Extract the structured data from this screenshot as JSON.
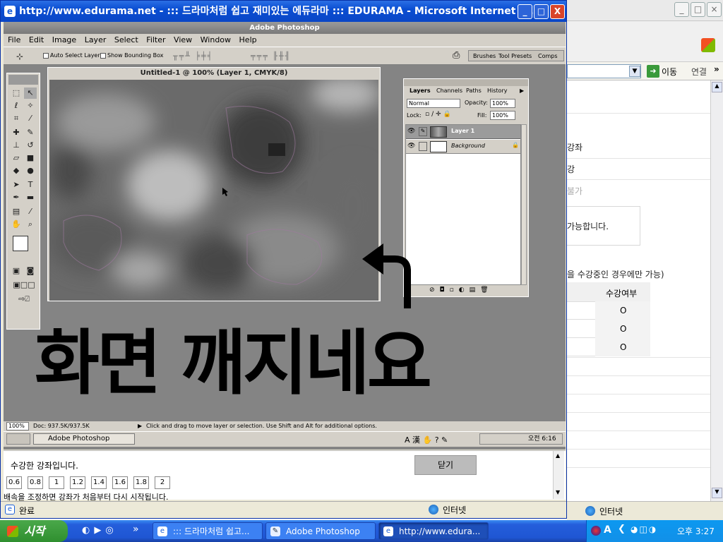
{
  "front_window": {
    "title": "http://www.edurama.net - ::: 드라마처럼 쉽고 재미있는 에듀라마 ::: EDURAMA - Microsoft Internet E...",
    "controls": [
      "_",
      "□",
      "X"
    ],
    "status": "완료",
    "zone": "인터넷"
  },
  "photoshop": {
    "title": "Adobe Photoshop",
    "menu": [
      "File",
      "Edit",
      "Image",
      "Layer",
      "Select",
      "Filter",
      "View",
      "Window",
      "Help"
    ],
    "options": {
      "auto_select": "Auto Select Layer",
      "show_bounding": "Show Bounding Box",
      "palette_tabs": [
        "Brushes",
        "Tool Presets",
        "Comps"
      ]
    },
    "document_title": "Untitled-1 @ 100% (Layer 1, CMYK/8)",
    "layers_panel": {
      "tabs": [
        "Layers",
        "Channels",
        "Paths",
        "History"
      ],
      "blend_mode": "Normal",
      "opacity_label": "Opacity:",
      "opacity_value": "100%",
      "lock_label": "Lock:",
      "fill_label": "Fill:",
      "fill_value": "100%",
      "layers": [
        {
          "name": "Layer 1",
          "selected": true
        },
        {
          "name": "Background",
          "selected": false
        }
      ]
    },
    "status": {
      "zoom": "100%",
      "doc": "Doc: 937.5K/937.5K",
      "hint": "Click and drag to move layer or selection.  Use Shift and Alt for additional options."
    },
    "inner_taskbar": {
      "task": "Adobe Photoshop",
      "clock": "오전 6:16"
    }
  },
  "overlay_text": "화면 깨지네요",
  "lecture_panel": {
    "message": "수강한 강좌입니다.",
    "close_button": "닫기",
    "speeds": [
      "0.6",
      "0.8",
      "1",
      "1.2",
      "1.4",
      "1.6",
      "1.8",
      "2"
    ],
    "note": "배속을 조정하면 강좌가 처음부터 다시 시작됩니다."
  },
  "background_window": {
    "go_label": "이동",
    "links_label": "연결",
    "rows": [
      "강좌",
      "강",
      "불가",
      "가능합니다.",
      "을 수강중인 경우에만 가능)"
    ],
    "table_header": "수강여부",
    "table_values": [
      "O",
      "O",
      "O"
    ],
    "zone": "인터넷"
  },
  "taskbar": {
    "start": "시작",
    "tasks": [
      "::: 드라마처럼 쉽고...",
      "Adobe Photoshop",
      "http://www.edura..."
    ],
    "clock": "오후 3:27"
  },
  "colors": {
    "xp_blue": "#245edb",
    "title_blue": "#0a4ed2",
    "start_green": "#2f8f2f"
  }
}
